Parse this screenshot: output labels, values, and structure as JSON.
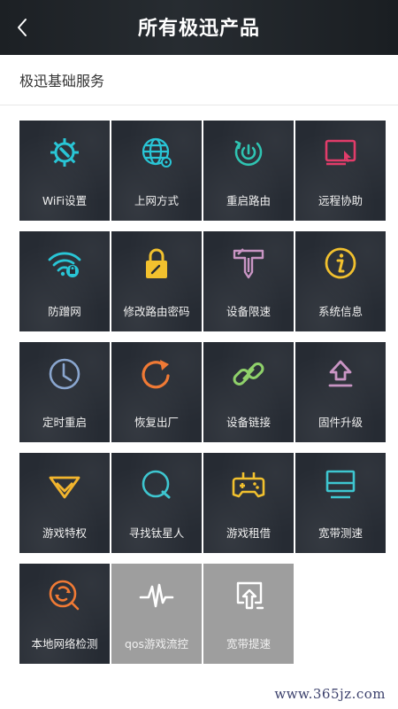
{
  "header": {
    "title": "所有极迅产品",
    "back_icon": "chevron-left-icon"
  },
  "section": {
    "title": "极迅基础服务"
  },
  "tiles": [
    {
      "label": "WiFi设置",
      "icon": "gear-wrench-icon",
      "color": "#29c6d6"
    },
    {
      "label": "上网方式",
      "icon": "globe-network-icon",
      "color": "#29c6d6"
    },
    {
      "label": "重启路由",
      "icon": "power-restart-icon",
      "color": "#2fc4b2"
    },
    {
      "label": "远程协助",
      "icon": "remote-screen-icon",
      "color": "#e23c6a"
    },
    {
      "label": "防蹭网",
      "icon": "wifi-lock-icon",
      "color": "#29c6d6"
    },
    {
      "label": "修改路由密码",
      "icon": "padlock-icon",
      "color": "#f2c12e"
    },
    {
      "label": "设备限速",
      "icon": "speed-limit-arrows-icon",
      "color": "#c995c4"
    },
    {
      "label": "系统信息",
      "icon": "info-icon",
      "color": "#f2c12e"
    },
    {
      "label": "定时重启",
      "icon": "clock-icon",
      "color": "#8aa6cf"
    },
    {
      "label": "恢复出厂",
      "icon": "refresh-icon",
      "color": "#f07a35"
    },
    {
      "label": "设备链接",
      "icon": "link-icon",
      "color": "#8fd16a"
    },
    {
      "label": "固件升级",
      "icon": "upload-icon",
      "color": "#c995c4"
    },
    {
      "label": "游戏特权",
      "icon": "diamond-icon",
      "color": "#f2b52e"
    },
    {
      "label": "寻找钛星人",
      "icon": "search-q-icon",
      "color": "#3ec6d0"
    },
    {
      "label": "游戏租借",
      "icon": "gamepad-icon",
      "color": "#f2c12e"
    },
    {
      "label": "宽带测速",
      "icon": "monitor-speed-icon",
      "color": "#3ec6d0"
    },
    {
      "label": "本地网络检测",
      "icon": "network-scan-icon",
      "color": "#f07a35"
    },
    {
      "label": "qos游戏流控",
      "icon": "pulse-wave-icon",
      "color": "#ffffff"
    },
    {
      "label": "宽带提速",
      "icon": "screen-upload-icon",
      "color": "#ffffff"
    }
  ],
  "watermark": "www.365jz.com"
}
